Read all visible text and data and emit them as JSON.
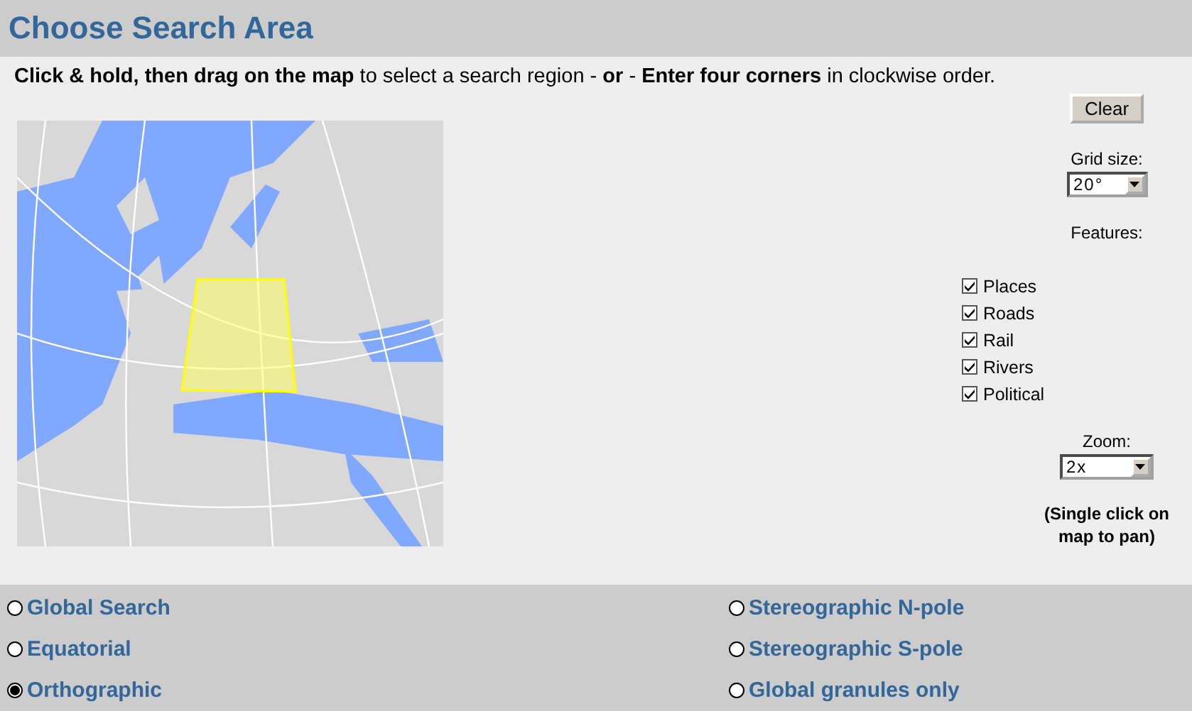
{
  "header": {
    "title": "Choose Search Area"
  },
  "instructions": "**Click & hold, then drag on the map** to select a search region - **or** - **Enter four corners** in clockwise order.",
  "clear_button": "Clear",
  "grid_size": {
    "label": "Grid size:",
    "value": "20°"
  },
  "features": {
    "label": "Features:",
    "items": [
      {
        "label": "Places",
        "checked": true
      },
      {
        "label": "Roads",
        "checked": true
      },
      {
        "label": "Rail",
        "checked": true
      },
      {
        "label": "Rivers",
        "checked": true
      },
      {
        "label": "Political",
        "checked": true
      }
    ]
  },
  "zoom": {
    "label": "Zoom:",
    "value": "2x"
  },
  "pan_hint": "(Single click on map to pan)",
  "projections": [
    {
      "label": "Global Search",
      "selected": false
    },
    {
      "label": "Stereographic N-pole",
      "selected": false
    },
    {
      "label": "Equatorial",
      "selected": false
    },
    {
      "label": "Stereographic S-pole",
      "selected": false
    },
    {
      "label": "Orthographic",
      "selected": true
    },
    {
      "label": "Global granules only",
      "selected": false
    }
  ]
}
